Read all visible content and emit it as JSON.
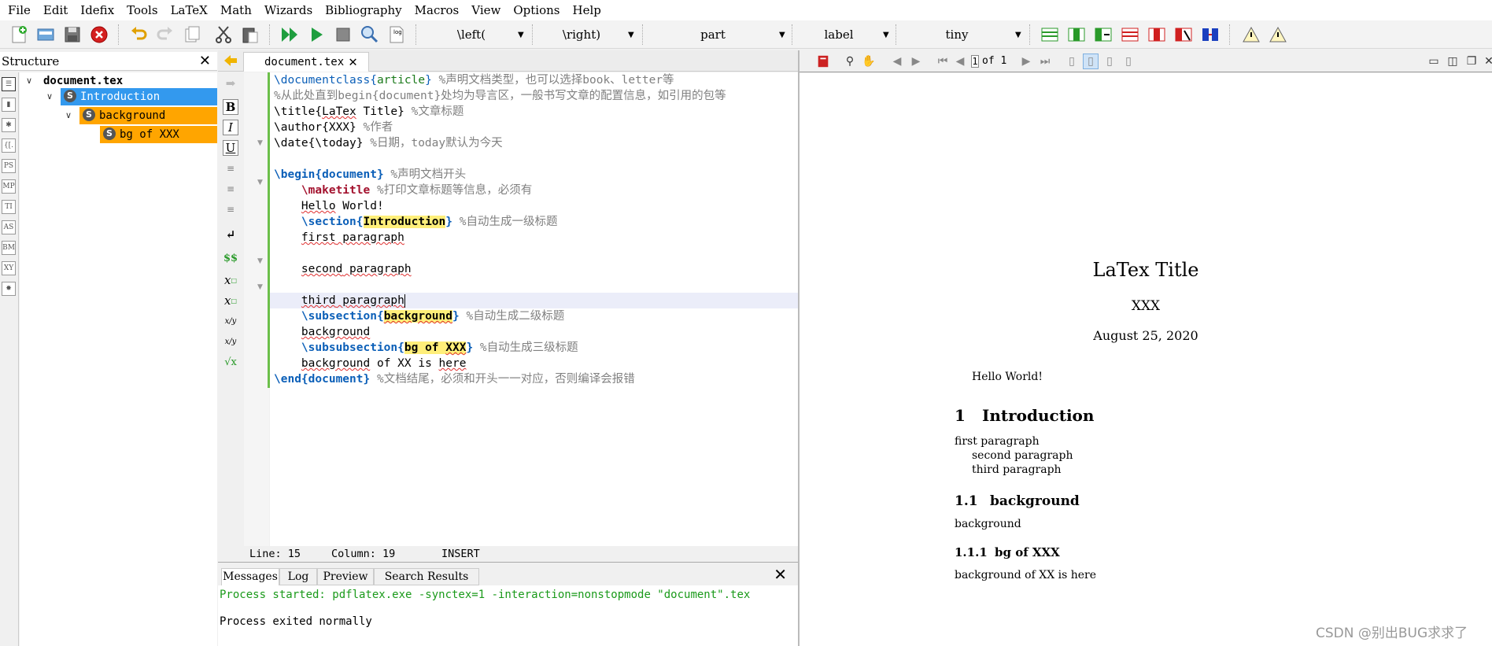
{
  "menu": [
    "File",
    "Edit",
    "Idefix",
    "Tools",
    "LaTeX",
    "Math",
    "Wizards",
    "Bibliography",
    "Macros",
    "View",
    "Options",
    "Help"
  ],
  "toolbar": {
    "left_combo": "\\left(",
    "right_combo": "\\right)",
    "sectioning_combo": "part",
    "ref_combo": "label",
    "size_combo": "tiny"
  },
  "structure": {
    "title": "Structure",
    "close": "✕",
    "root": "document.tex",
    "nodes": [
      {
        "label": "Introduction",
        "badge": "S"
      },
      {
        "label": "background",
        "badge": "S"
      },
      {
        "label": "bg of XXX",
        "badge": "S"
      }
    ]
  },
  "format_bar": {
    "bold": "B",
    "italic": "I",
    "underline": "U",
    "math": "$$",
    "sub": "x",
    "sup": "x",
    "frac": "x/y",
    "dfrac": "x/y",
    "sqrt": "√x"
  },
  "editor": {
    "tab": "document.tex",
    "tab_close": "✕",
    "lines": {
      "l1_cmd": "\\documentclass{",
      "l1_arg": "article",
      "l1_end": "}",
      "l1_cm": " %声明文档类型，也可以选择book、letter等",
      "l2_cm": "%从此处直到begin{document}处均为导言区，一般书写文章的配置信息，如引用的包等",
      "l3_cmd": "\\title{",
      "l3_arg": "LaTex",
      "l3_rest": " Title}",
      "l3_cm": " %文章标题",
      "l4_cmd": "\\author{XXX}",
      "l4_cm": " %作者",
      "l5_cmd": "\\date{\\today}",
      "l5_cm": " %日期，today默认为今天",
      "l7_cmd": "\\begin{",
      "l7_arg": "document",
      "l7_end": "}",
      "l7_cm": " %声明文档开头",
      "l8_cmd": "\\maketitle",
      "l8_cm": " %打印文章标题等信息，必须有",
      "l9_a": "Hello",
      "l9_b": " World!",
      "l10_cmd": "\\section{",
      "l10_arg": "Introduction",
      "l10_end": "}",
      "l10_cm": " %自动生成一级标题",
      "l11_a": "first",
      "l11_b": " paragraph",
      "l13_a": "second",
      "l13_b": " paragraph",
      "l15_a": "third",
      "l15_b": " paragraph",
      "l16_cmd": "\\subsection{",
      "l16_arg": "background",
      "l16_end": "}",
      "l16_cm": " %自动生成二级标题",
      "l17": "background",
      "l18_cmd": "\\subsubsection{",
      "l18_arg1": "bg of ",
      "l18_arg2": "XXX",
      "l18_end": "}",
      "l18_cm": " %自动生成三级标题",
      "l19_a": "background",
      "l19_b": " of XX is ",
      "l19_c": "here",
      "l20_cmd": "\\end{",
      "l20_arg": "document",
      "l20_end": "}",
      "l20_cm": " %文档结尾，必须和开头一一对应，否则编译会报错"
    }
  },
  "status": {
    "line": "Line: 15",
    "column": "Column: 19",
    "mode": "INSERT"
  },
  "messages": {
    "tabs": [
      "Messages",
      "Log",
      "Preview",
      "Search Results"
    ],
    "close": "✕",
    "line1": "Process started: pdflatex.exe -synctex=1 -interaction=nonstopmode \"document\".tex",
    "line2": "Process exited normally"
  },
  "pdf": {
    "page_input": "1",
    "page_of": "of 1",
    "title": "LaTex Title",
    "author": "XXX",
    "date": "August 25, 2020",
    "hello": "Hello World!",
    "sec_num": "1",
    "sec_title": "Introduction",
    "p1": "first paragraph",
    "p2": "second paragraph",
    "p3": "third paragraph",
    "subsec_num": "1.1",
    "subsec_title": "background",
    "subsec_body": "background",
    "subsubsec_num": "1.1.1",
    "subsubsec_title": "bg of XXX",
    "subsubsec_body": "background of XX is here"
  },
  "watermark": "CSDN @别出BUG求求了"
}
